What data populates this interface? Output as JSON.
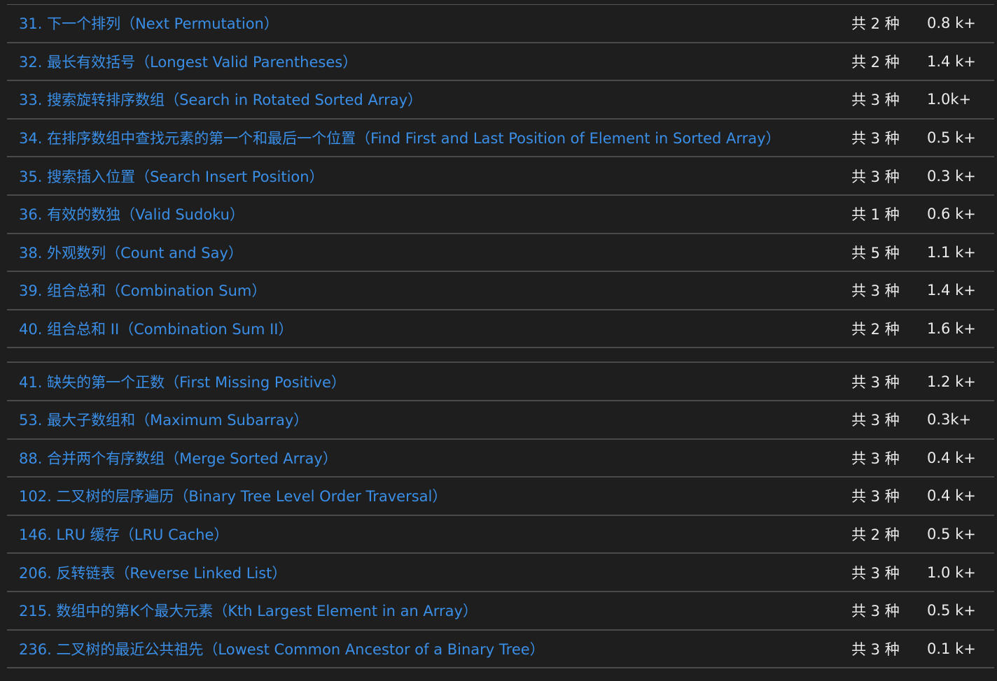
{
  "rows_a": [
    {
      "title": "31. 下一个排列（Next Permutation）",
      "count": "共 2 种",
      "views": "0.8 k+"
    },
    {
      "title": "32. 最长有效括号（Longest Valid Parentheses）",
      "count": "共 2 种",
      "views": "1.4 k+"
    },
    {
      "title": "33. 搜索旋转排序数组（Search in Rotated Sorted Array）",
      "count": "共 3 种",
      "views": "1.0k+"
    },
    {
      "title": "34. 在排序数组中查找元素的第一个和最后一个位置（Find First and Last Position of Element in Sorted Array）",
      "count": "共 3 种",
      "views": "0.5 k+"
    },
    {
      "title": "35. 搜索插入位置（Search Insert Position）",
      "count": "共 3 种",
      "views": "0.3 k+"
    },
    {
      "title": "36. 有效的数独（Valid Sudoku）",
      "count": "共 1 种",
      "views": "0.6 k+"
    },
    {
      "title": "38. 外观数列（Count and Say）",
      "count": "共 5 种",
      "views": "1.1 k+"
    },
    {
      "title": "39. 组合总和（Combination Sum）",
      "count": "共 3 种",
      "views": "1.4 k+"
    },
    {
      "title": "40. 组合总和 II（Combination Sum II）",
      "count": "共 2 种",
      "views": "1.6 k+"
    }
  ],
  "rows_b": [
    {
      "title": "41. 缺失的第一个正数（First Missing Positive）",
      "count": "共 3 种",
      "views": "1.2 k+"
    },
    {
      "title": "53. 最大子数组和（Maximum Subarray）",
      "count": "共 3 种",
      "views": "0.3k+"
    },
    {
      "title": "88. 合并两个有序数组（Merge Sorted Array）",
      "count": "共 3 种",
      "views": "0.4 k+"
    },
    {
      "title": "102. 二叉树的层序遍历（Binary Tree Level Order Traversal）",
      "count": "共 3 种",
      "views": "0.4 k+"
    },
    {
      "title": "146. LRU 缓存（LRU Cache）",
      "count": "共 2 种",
      "views": "0.5 k+"
    },
    {
      "title": "206. 反转链表（Reverse Linked List）",
      "count": "共 3 种",
      "views": "1.0 k+"
    },
    {
      "title": "215. 数组中的第K个最大元素（Kth Largest Element in an Array）",
      "count": "共 3 种",
      "views": "0.5 k+"
    },
    {
      "title": "236. 二叉树的最近公共祖先（Lowest Common Ancestor of a Binary Tree）",
      "count": "共 3 种",
      "views": "0.1 k+"
    }
  ],
  "colors": {
    "background": "#1e1e1e",
    "link": "#3a8ee6",
    "text": "#ececec",
    "divider": "#4a4a4a"
  }
}
